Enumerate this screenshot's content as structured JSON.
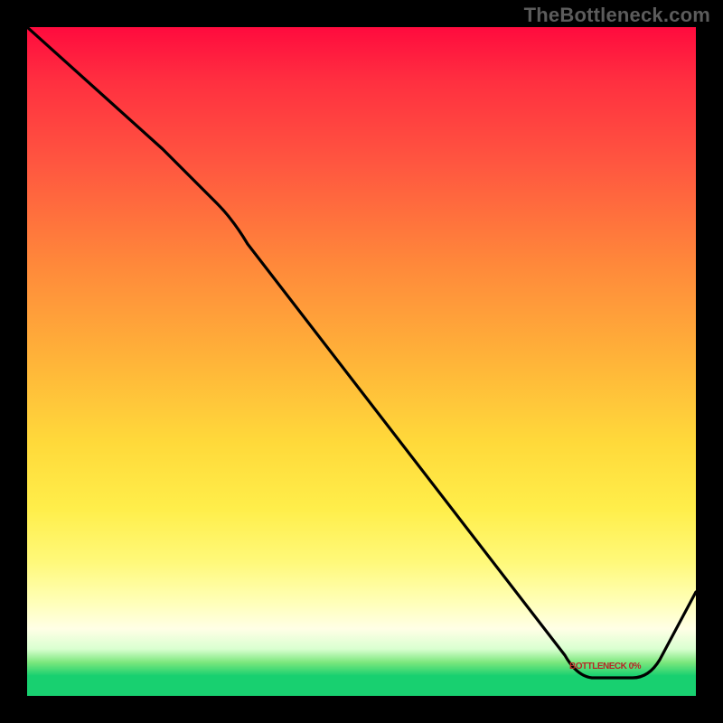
{
  "watermark": "TheBottleneck.com",
  "chart_data": {
    "type": "line",
    "title": "",
    "xlabel": "",
    "ylabel": "",
    "xlim": [
      0,
      1
    ],
    "ylim": [
      0,
      1
    ],
    "grid": false,
    "legend": false,
    "background": "heat-gradient-vertical",
    "gradient_stops": [
      {
        "pos": 0.0,
        "color": "#ff0b3e"
      },
      {
        "pos": 0.2,
        "color": "#ff5540"
      },
      {
        "pos": 0.5,
        "color": "#ffb439"
      },
      {
        "pos": 0.72,
        "color": "#ffee4a"
      },
      {
        "pos": 0.9,
        "color": "#ffffe6"
      },
      {
        "pos": 0.97,
        "color": "#18d070"
      }
    ],
    "series": [
      {
        "name": "bottleneck-curve",
        "color": "#000000",
        "x": [
          0.0,
          0.2,
          0.28,
          0.33,
          0.8,
          0.84,
          0.9,
          0.95,
          1.0
        ],
        "y": [
          1.0,
          0.82,
          0.74,
          0.68,
          0.06,
          0.03,
          0.03,
          0.05,
          0.15
        ]
      }
    ],
    "annotation": {
      "text": "BOTTLENECK 0%",
      "x": 0.85,
      "y": 0.03,
      "color": "#b72626"
    }
  }
}
